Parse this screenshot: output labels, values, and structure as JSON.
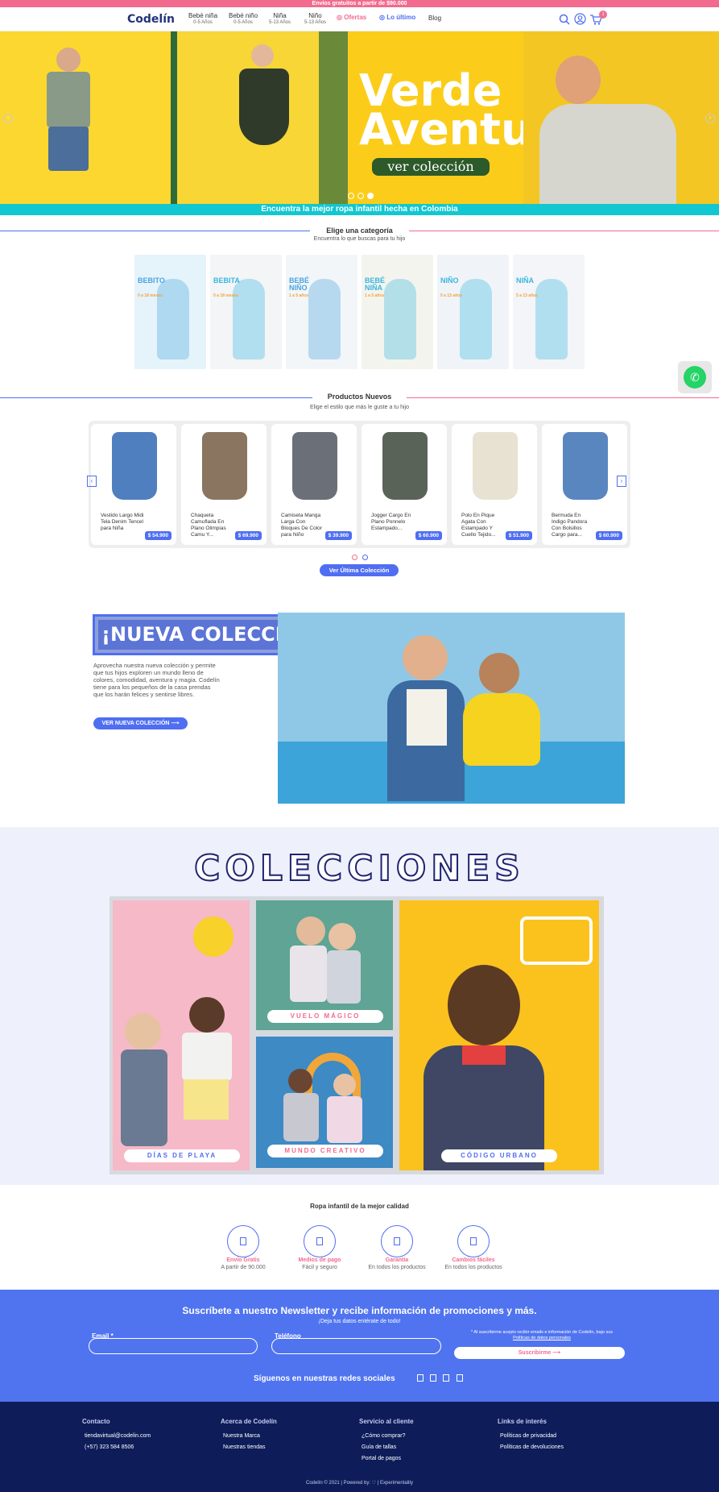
{
  "topbar": {
    "text": "Envíos gratuitos a partir de $90.000"
  },
  "header": {
    "logo": "Codelín",
    "nav": [
      {
        "label": "Bebé niña",
        "sub": "0-5 Años"
      },
      {
        "label": "Bebé niño",
        "sub": "0-5 Años"
      },
      {
        "label": "Niña",
        "sub": "5-13 Años"
      },
      {
        "label": "Niño",
        "sub": "5-13 Años"
      }
    ],
    "ofertas": "Ofertas",
    "ultimo": "Lo último",
    "blog": "Blog",
    "cart_count": "1"
  },
  "hero": {
    "title_line1": "Verde",
    "title_line2": "Aventura",
    "cta": "ver colección"
  },
  "band": {
    "text": "Encuentra la mejor ropa infantil hecha en Colombia"
  },
  "categories": {
    "title": "Elige una categoría",
    "subtitle": "Encuentra lo que buscas para tu hijo",
    "items": [
      {
        "label": "BEBITO",
        "sub": "0 a 18 meses",
        "bg": "#e5f4fb",
        "accent": "#4aa3df"
      },
      {
        "label": "BEBITA",
        "sub": "0 a 18 meses",
        "bg": "#f3f5f7",
        "accent": "#38b6e0"
      },
      {
        "label": "BEBÉ NIÑO",
        "sub": "1 a 5 años",
        "bg": "#f2f6f9",
        "accent": "#4aa3df"
      },
      {
        "label": "BEBÉ NIÑA",
        "sub": "1 a 5 años",
        "bg": "#f4f4ee",
        "accent": "#38b6e0"
      },
      {
        "label": "NIÑO",
        "sub": "5 a 13 años",
        "bg": "#f0f4f8",
        "accent": "#38b6e0"
      },
      {
        "label": "NIÑA",
        "sub": "5 a 13 años",
        "bg": "#f3f5f8",
        "accent": "#38b6e0"
      }
    ]
  },
  "products": {
    "title": "Productos Nuevos",
    "subtitle": "Elige el estilo que más le guste a tu hijo",
    "items": [
      {
        "name": "Vestido Largo Midi Tela Denim Tencel para Niña",
        "price": "$ 54.900",
        "color": "#4f7fbf"
      },
      {
        "name": "Chaqueta Camuflada En Plano Olimpias Camu Y...",
        "price": "$ 69.900",
        "color": "#8a7560"
      },
      {
        "name": "Camiseta Manga Larga Con Bloques De Color para Niño",
        "price": "$ 39.900",
        "color": "#6b7078"
      },
      {
        "name": "Jogger Cargo En Plano Ponnelo Estampado...",
        "price": "$ 60.900",
        "color": "#5a6358"
      },
      {
        "name": "Polo En Pique Agata Con Estampado Y Cuello Tejido...",
        "price": "$ 51.900",
        "color": "#e8e2d2"
      },
      {
        "name": "Bermuda En Indigo Pandora Con Bolsillos Cargo para...",
        "price": "$ 60.900",
        "color": "#5a86c0"
      }
    ],
    "cta": "Ver Última Colección"
  },
  "nueva": {
    "title": "¡NUEVA COLECCIÓN!",
    "body": "Aprovecha nuestra nueva colección y permite que tus hijos exploren un mundo lleno de colores, comodidad, aventura y magia. Codelín tiene para los pequeños de la casa prendas que los harán felices y sentirse libres.",
    "cta": "VER NUEVA COLECCIÓN"
  },
  "colecciones": {
    "title": "COLECCIONES",
    "items": [
      {
        "label": "DÍAS DE PLAYA",
        "color": "#4f6ef2"
      },
      {
        "label": "VUELO MÁGICO",
        "color": "#f26b8e"
      },
      {
        "label": "MUNDO CREATIVO",
        "color": "#f26b8e"
      },
      {
        "label": "CÓDIGO URBANO",
        "color": "#4f6ef2"
      }
    ]
  },
  "features": {
    "title": "Ropa infantil de la mejor calidad",
    "items": [
      {
        "title": "Envío Gratis",
        "sub": "A partir de 90.000"
      },
      {
        "title": "Medios de pago",
        "sub": "Fácil y seguro"
      },
      {
        "title": "Garantía",
        "sub": "En todos los productos"
      },
      {
        "title": "Cambios fáciles",
        "sub": "En todos los productos"
      }
    ]
  },
  "newsletter": {
    "title": "Suscríbete a nuestro Newsletter y recibe información de promociones y más.",
    "subtitle": "¡Deja tus datos entérate de todo!",
    "email_label": "Email *",
    "phone_label": "Teléfono",
    "consent": "* Al suscribirme acepto recibir emails e información de Codelín, bajo sus",
    "consent_link": "Políticas de datos personales",
    "submit": "Suscribirme ⟶",
    "social": "Síguenos en nuestras redes sociales"
  },
  "footer": {
    "cols": [
      {
        "title": "Contacto",
        "links": [
          "tiendavirtual@codelin.com",
          "(+57) 323 584 8506"
        ]
      },
      {
        "title": "Acerca de Codelín",
        "links": [
          "Nuestra Marca",
          "Nuestras tiendas"
        ]
      },
      {
        "title": "Servicio al cliente",
        "links": [
          "¿Cómo comprar?",
          "Guía de tallas",
          "Portal de pagos"
        ]
      },
      {
        "title": "Links de interés",
        "links": [
          "Políticas de privacidad",
          "Políticas de devoluciones"
        ]
      }
    ],
    "copyright": "Codelín © 2021 | Powered by:",
    "powered": "| Experimentality"
  },
  "colors": {
    "brand_blue": "#4f6ef2",
    "brand_pink": "#f26b8e",
    "navy": "#0e1c59",
    "teal": "#12c7cf",
    "yellow": "#fbcd1a"
  }
}
